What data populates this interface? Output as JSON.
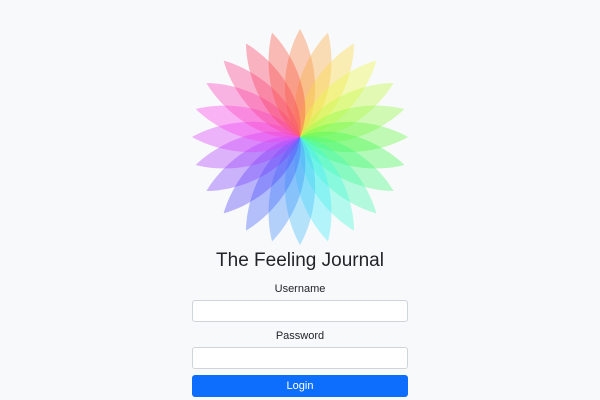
{
  "app": {
    "title": "The Feeling Journal"
  },
  "login": {
    "username_label": "Username",
    "username_value": "",
    "password_label": "Password",
    "password_value": "",
    "submit_label": "Login"
  },
  "logo": {
    "icon": "rainbow-flower-logo",
    "petal_count": 24
  },
  "colors": {
    "background": "#f8f9fa",
    "primary": "#0d6efd",
    "input_border": "#ced4da",
    "text": "#212529"
  }
}
